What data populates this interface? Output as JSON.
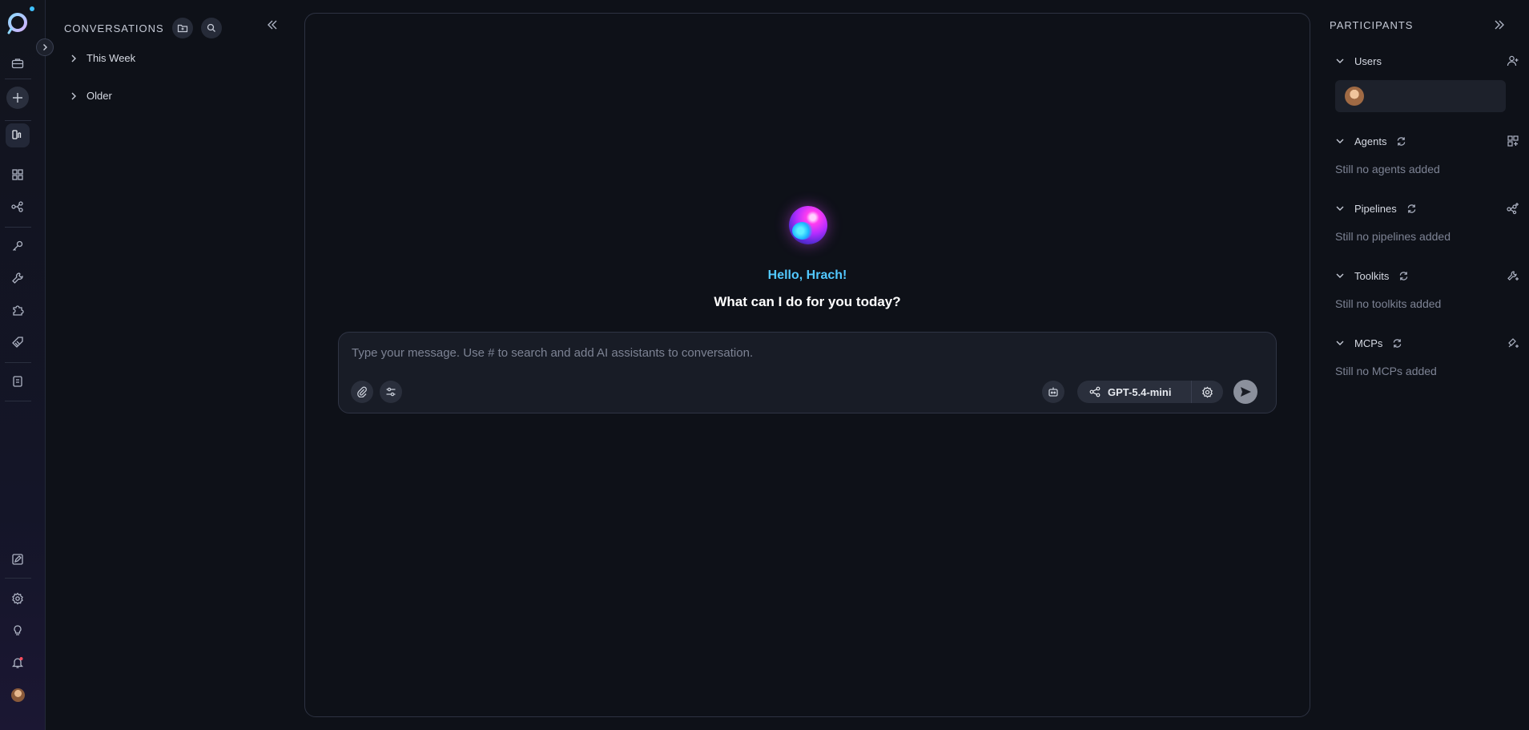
{
  "conversations": {
    "title": "CONVERSATIONS",
    "groups": [
      {
        "label": "This Week"
      },
      {
        "label": "Older"
      }
    ]
  },
  "chat": {
    "greeting": "Hello, Hrach!",
    "prompt": "What can I do for you today?",
    "input_placeholder": "Type your message. Use # to search and add AI assistants to conversation.",
    "model_name": "GPT-5.4-mini"
  },
  "participants": {
    "title": "PARTICIPANTS",
    "sections": {
      "users": {
        "label": "Users"
      },
      "agents": {
        "label": "Agents",
        "empty": "Still no agents added"
      },
      "pipelines": {
        "label": "Pipelines",
        "empty": "Still no pipelines added"
      },
      "toolkits": {
        "label": "Toolkits",
        "empty": "Still no toolkits added"
      },
      "mcps": {
        "label": "MCPs",
        "empty": "Still no MCPs added"
      }
    }
  },
  "colors": {
    "background": "#0e1118",
    "accent_blue": "#52c8ff",
    "notification_red": "#ff4d5e"
  },
  "icons": {
    "rail": [
      "app-logo",
      "briefcase-icon",
      "plus-icon",
      "chat-icon",
      "grid-icon",
      "pipeline-icon",
      "key-icon",
      "wrench-icon",
      "puzzle-icon",
      "tag-icon",
      "document-icon",
      "edit-icon",
      "settings-icon",
      "lightbulb-icon",
      "bell-icon"
    ]
  }
}
